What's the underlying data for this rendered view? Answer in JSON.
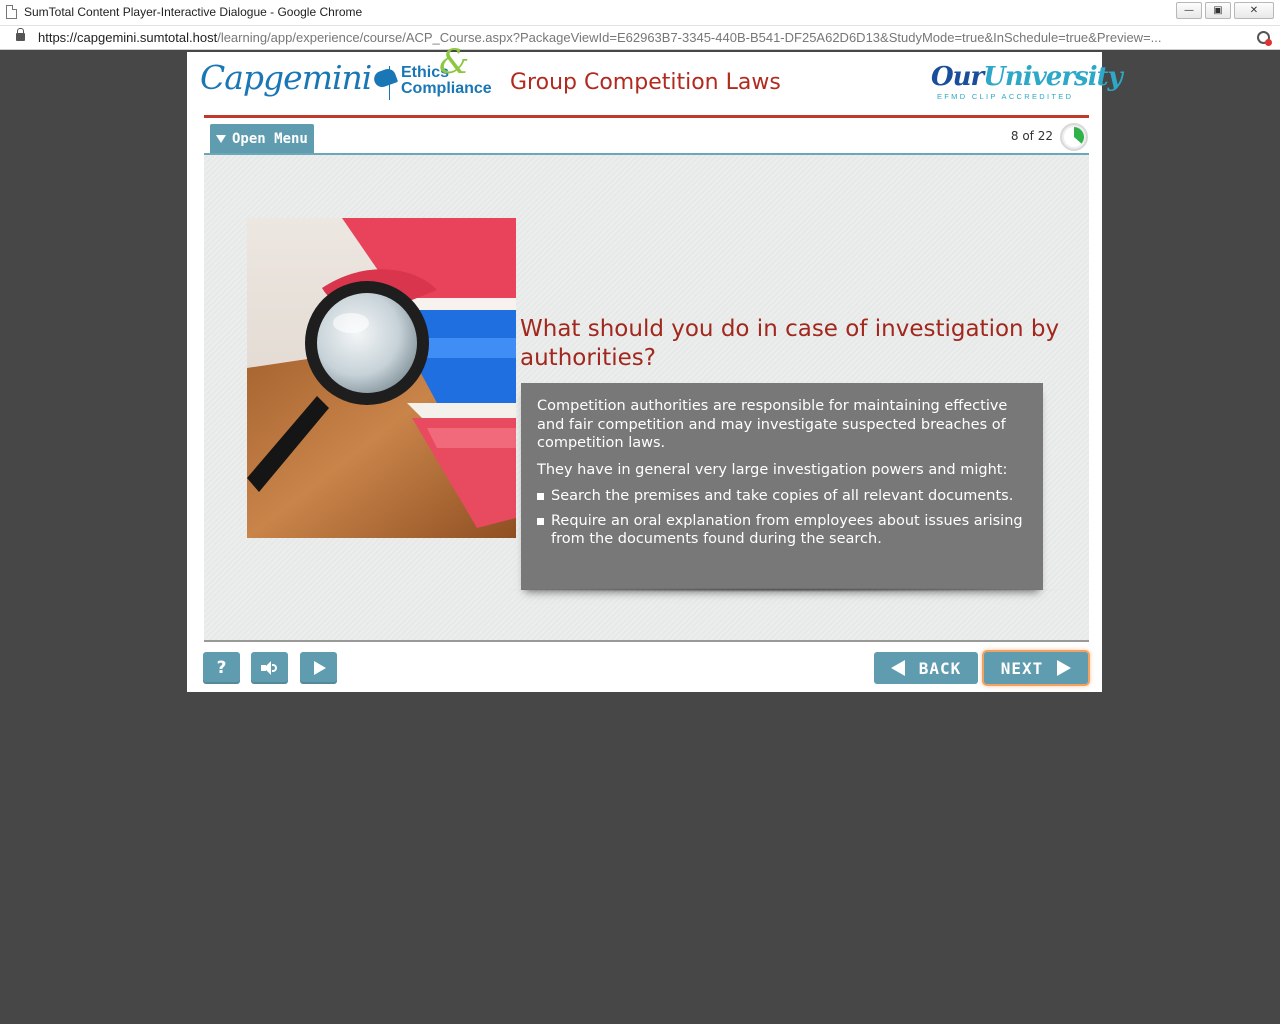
{
  "window": {
    "title": "SumTotal Content Player-Interactive Dialogue - Google Chrome",
    "url_host": "https://capgemini.sumtotal.host",
    "url_path": "/learning/app/experience/course/ACP_Course.aspx?PackageViewId=E62963B7-3345-440B-B541-DF25A62D6D13&StudyMode=true&InSchedule=true&Preview=..."
  },
  "header": {
    "brand": "Capgemini",
    "ethics_line1": "Ethics",
    "ethics_amp": "&",
    "ethics_line2": "Compliance",
    "course_title": "Group Competition Laws",
    "university_our": "Our",
    "university_name": "University",
    "university_tagline": "EFMD CLIP ACCREDITED"
  },
  "menu": {
    "open_menu_label": "Open Menu",
    "progress_text": "8 of 22",
    "progress_fraction": 0.364
  },
  "slide": {
    "question": "What should you do in case of investigation by authorities?",
    "paragraph1": "Competition authorities are responsible for maintaining effective and fair competition and may investigate suspected breaches of competition laws.",
    "paragraph2": "They have in general very large investigation powers and might:",
    "bullets": [
      "Search the premises and take copies of all relevant documents.",
      "Require an oral explanation from employees about issues arising from the documents found during the search."
    ]
  },
  "footer": {
    "help_label": "?",
    "back_label": "BACK",
    "next_label": "NEXT"
  },
  "colors": {
    "accent_teal": "#5f9caf",
    "title_red": "#a2271d",
    "brand_blue": "#1a77b6",
    "progress_green": "#2fb24a",
    "next_highlight": "#f3a15f"
  },
  "icons": [
    "doc-icon",
    "lock-icon",
    "extension-icon",
    "spade-icon",
    "caret-down-icon",
    "progress-pie-icon",
    "magnifier-photo",
    "bullet-icon",
    "speaker-icon",
    "play-icon",
    "tri-left-icon",
    "tri-right-icon"
  ]
}
